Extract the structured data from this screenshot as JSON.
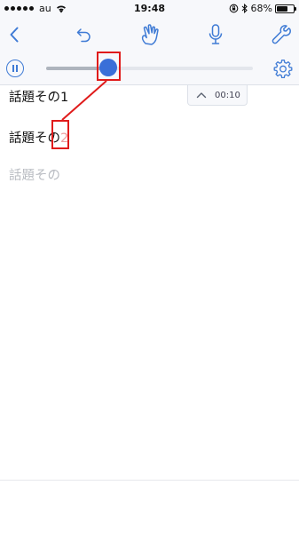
{
  "status_bar": {
    "carrier": "au",
    "time": "19:48",
    "battery_percent": "68%",
    "battery_level": 0.68,
    "signal_bars": 5
  },
  "toolbar": {
    "icons": [
      "back-icon",
      "undo-icon",
      "hand-pointer-icon",
      "microphone-icon",
      "wrench-icon"
    ]
  },
  "player": {
    "progress_fraction": 0.3,
    "elapsed_time": "00:10"
  },
  "document": {
    "lines": [
      {
        "text": "話題その1",
        "style": "normal"
      },
      {
        "text_prefix": "話題その",
        "text_highlight": "2",
        "style": "normal"
      },
      {
        "text": "話題その",
        "style": "placeholder"
      }
    ]
  },
  "colors": {
    "accent": "#3a6fd8",
    "annotation": "#e01b1b",
    "toolbar_background": "#f7f8fb",
    "placeholder_text": "#b9bcc2"
  }
}
